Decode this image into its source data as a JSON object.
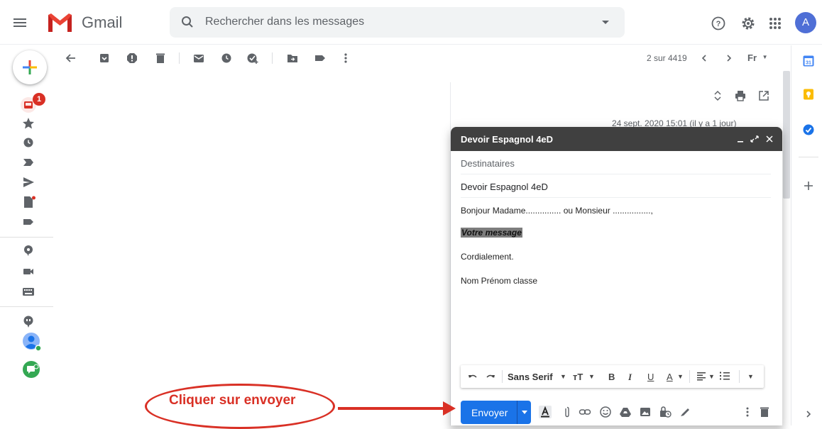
{
  "header": {
    "brand": "Gmail",
    "search_placeholder": "Rechercher dans les messages",
    "avatar_letter": "A"
  },
  "rail": {
    "inbox_badge": "1"
  },
  "toolbar": {
    "counter": "2 sur 4419",
    "input_tool": "Fr"
  },
  "thread": {
    "partial_date": "24 sept. 2020 15:01 (il y a 1 jour)"
  },
  "compose": {
    "title": "Devoir Espagnol 4eD",
    "recipients_placeholder": "Destinataires",
    "subject": "Devoir Espagnol 4eD",
    "body": {
      "line1": "Bonjour Madame............... ou Monsieur ................,",
      "line2": "Votre message",
      "line3": "Cordialement.",
      "line4": "Nom Prénom classe"
    },
    "format_bar": {
      "font": "Sans Serif",
      "bold": "B",
      "italic": "I",
      "underline": "U",
      "text_color": "A"
    },
    "send_label": "Envoyer"
  },
  "annotation": {
    "text": "Cliquer sur envoyer"
  },
  "colors": {
    "send": "#1a73e8",
    "annotation": "#d93025",
    "compose_header": "#404040"
  }
}
